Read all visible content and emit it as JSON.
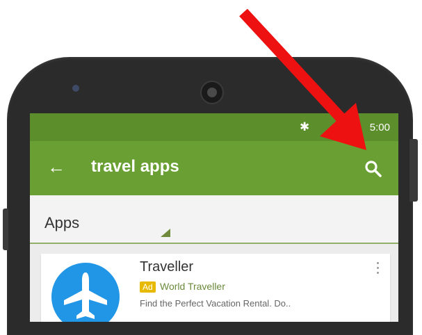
{
  "status_bar": {
    "time": "5:00",
    "icons": [
      "bluetooth-icon"
    ]
  },
  "toolbar": {
    "back_icon": "arrow-left-icon",
    "query": "travel apps",
    "search_icon": "search-icon"
  },
  "section": {
    "title": "Apps"
  },
  "result": {
    "app_name": "Traveller",
    "ad_label": "Ad",
    "developer": "World Traveller",
    "description": "Find the Perfect Vacation Rental. Do..",
    "icon": "airplane-icon",
    "menu_icon": "more-vert-icon"
  },
  "colors": {
    "status_bar": "#5c8f2c",
    "toolbar": "#6aa033",
    "app_icon_bg": "#2196e6",
    "ad_badge": "#e7b900",
    "annotation_arrow": "#ee1111"
  },
  "annotation": {
    "type": "arrow",
    "points_to": "search-icon"
  }
}
